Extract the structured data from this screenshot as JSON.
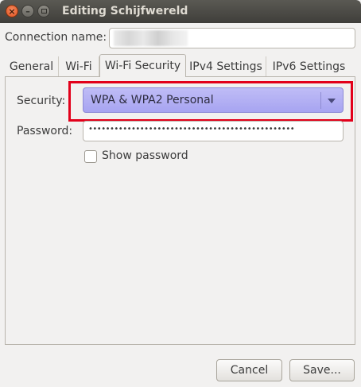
{
  "window": {
    "title": "Editing Schijfwereld",
    "close_glyph": "×",
    "minimize_glyph": "–"
  },
  "connection": {
    "label": "Connection name:",
    "value": ""
  },
  "tabs": [
    {
      "label": "General",
      "active": false
    },
    {
      "label": "Wi-Fi",
      "active": false
    },
    {
      "label": "Wi-Fi Security",
      "active": true
    },
    {
      "label": "IPv4 Settings",
      "active": false
    },
    {
      "label": "IPv6 Settings",
      "active": false
    }
  ],
  "security": {
    "label": "Security:",
    "selected": "WPA & WPA2 Personal",
    "highlight_color": "#e2001a",
    "combo_color": "#b1aef3"
  },
  "password": {
    "label": "Password:",
    "masked_value": "••••••••••••••••••••••••••••••••••••••••••••••••"
  },
  "show_password": {
    "label": "Show password",
    "checked": false
  },
  "buttons": {
    "cancel": "Cancel",
    "save": "Save..."
  },
  "icons": {
    "close": "close-icon",
    "minimize": "minimize-icon",
    "maximize": "maximize-icon",
    "dropdown": "chevron-down-icon"
  }
}
